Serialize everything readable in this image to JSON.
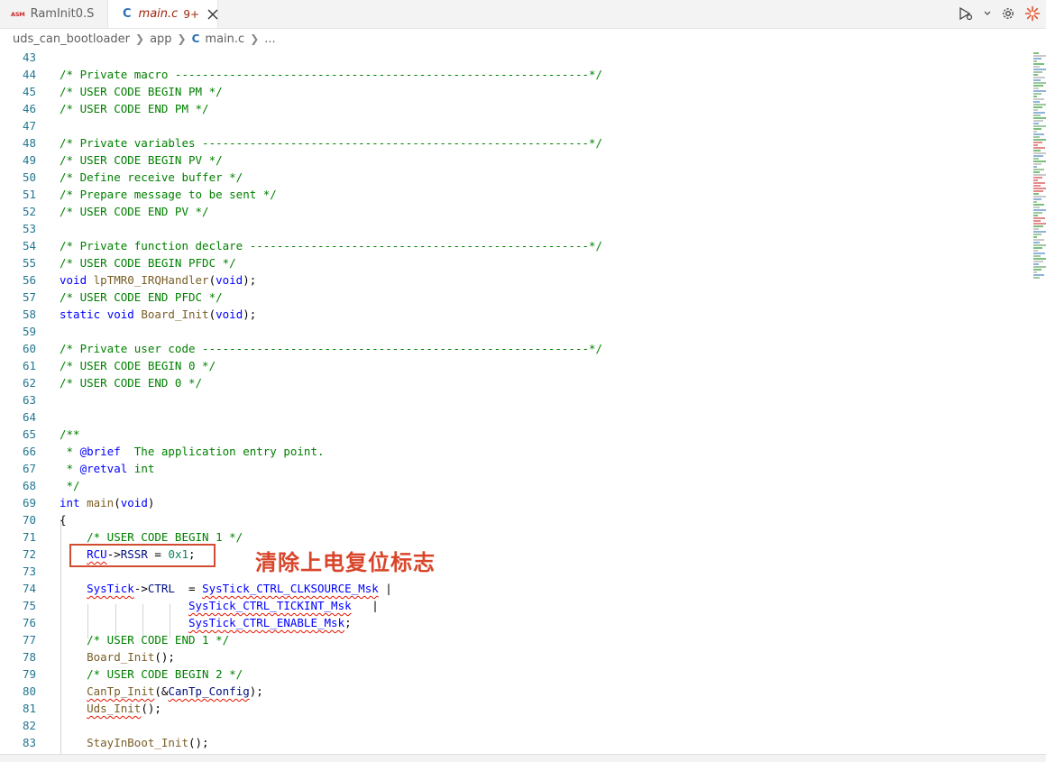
{
  "tabs": [
    {
      "badge": "ASM",
      "label": "RamInit0.S",
      "active": false
    },
    {
      "badge": "C",
      "label": "main.c",
      "problems": "9+",
      "active": true,
      "modified": true
    }
  ],
  "breadcrumb": [
    "uds_can_bootloader",
    "app",
    "main.c",
    "..."
  ],
  "annotation": {
    "text": "清除上电复位标志",
    "color": "#d8452a"
  },
  "colors": {
    "line_number": "#237893",
    "comment": "#008000",
    "keyword": "#0000ff",
    "function": "#795e26",
    "identifier": "#001080",
    "number": "#098658",
    "highlight_box": "#d14b30"
  },
  "icons": [
    "run-debug-icon",
    "chevron-down-icon",
    "gear-icon",
    "copilot-icon",
    "close-icon"
  ],
  "lines": [
    {
      "num": "43",
      "tokens": []
    },
    {
      "num": "44",
      "tokens": [
        {
          "t": "/* Private macro -------------------------------------------------------------*/",
          "c": "comment"
        }
      ]
    },
    {
      "num": "45",
      "tokens": [
        {
          "t": "/* USER CODE BEGIN PM */",
          "c": "comment"
        }
      ]
    },
    {
      "num": "46",
      "tokens": [
        {
          "t": "/* USER CODE END PM */",
          "c": "comment"
        }
      ]
    },
    {
      "num": "47",
      "tokens": []
    },
    {
      "num": "48",
      "tokens": [
        {
          "t": "/* Private variables ---------------------------------------------------------*/",
          "c": "comment"
        }
      ]
    },
    {
      "num": "49",
      "tokens": [
        {
          "t": "/* USER CODE BEGIN PV */",
          "c": "comment"
        }
      ]
    },
    {
      "num": "50",
      "tokens": [
        {
          "t": "/* Define receive buffer */",
          "c": "comment"
        }
      ]
    },
    {
      "num": "51",
      "tokens": [
        {
          "t": "/* Prepare message to be sent */",
          "c": "comment"
        }
      ]
    },
    {
      "num": "52",
      "tokens": [
        {
          "t": "/* USER CODE END PV */",
          "c": "comment"
        }
      ]
    },
    {
      "num": "53",
      "tokens": []
    },
    {
      "num": "54",
      "tokens": [
        {
          "t": "/* Private function declare --------------------------------------------------*/",
          "c": "comment"
        }
      ]
    },
    {
      "num": "55",
      "tokens": [
        {
          "t": "/* USER CODE BEGIN PFDC */",
          "c": "comment"
        }
      ]
    },
    {
      "num": "56",
      "tokens": [
        {
          "t": "void",
          "c": "keyword"
        },
        {
          "t": " ",
          "c": "plain"
        },
        {
          "t": "lpTMR0_IRQHandler",
          "c": "func"
        },
        {
          "t": "(",
          "c": "plain"
        },
        {
          "t": "void",
          "c": "keyword"
        },
        {
          "t": ");",
          "c": "plain"
        }
      ]
    },
    {
      "num": "57",
      "tokens": [
        {
          "t": "/* USER CODE END PFDC */",
          "c": "comment"
        }
      ]
    },
    {
      "num": "58",
      "tokens": [
        {
          "t": "static",
          "c": "keyword"
        },
        {
          "t": " ",
          "c": "plain"
        },
        {
          "t": "void",
          "c": "keyword"
        },
        {
          "t": " ",
          "c": "plain"
        },
        {
          "t": "Board_Init",
          "c": "func"
        },
        {
          "t": "(",
          "c": "plain"
        },
        {
          "t": "void",
          "c": "keyword"
        },
        {
          "t": ");",
          "c": "plain"
        }
      ]
    },
    {
      "num": "59",
      "tokens": []
    },
    {
      "num": "60",
      "tokens": [
        {
          "t": "/* Private user code ---------------------------------------------------------*/",
          "c": "comment"
        }
      ]
    },
    {
      "num": "61",
      "tokens": [
        {
          "t": "/* USER CODE BEGIN 0 */",
          "c": "comment"
        }
      ]
    },
    {
      "num": "62",
      "tokens": [
        {
          "t": "/* USER CODE END 0 */",
          "c": "comment"
        }
      ]
    },
    {
      "num": "63",
      "tokens": []
    },
    {
      "num": "64",
      "tokens": []
    },
    {
      "num": "65",
      "tokens": [
        {
          "t": "/**",
          "c": "comment"
        }
      ]
    },
    {
      "num": "66",
      "tokens": [
        {
          "t": " * ",
          "c": "comment"
        },
        {
          "t": "@brief",
          "c": "doctag"
        },
        {
          "t": "  The application entry point.",
          "c": "comment"
        }
      ]
    },
    {
      "num": "67",
      "tokens": [
        {
          "t": " * ",
          "c": "comment"
        },
        {
          "t": "@retval",
          "c": "doctag"
        },
        {
          "t": " int",
          "c": "comment"
        }
      ]
    },
    {
      "num": "68",
      "tokens": [
        {
          "t": " */",
          "c": "comment"
        }
      ]
    },
    {
      "num": "69",
      "tokens": [
        {
          "t": "int",
          "c": "keyword"
        },
        {
          "t": " ",
          "c": "plain"
        },
        {
          "t": "main",
          "c": "func"
        },
        {
          "t": "(",
          "c": "plain"
        },
        {
          "t": "void",
          "c": "keyword"
        },
        {
          "t": ")",
          "c": "plain"
        }
      ]
    },
    {
      "num": "70",
      "tokens": [
        {
          "t": "{",
          "c": "plain"
        }
      ]
    },
    {
      "num": "71",
      "tokens": [
        {
          "t": "    /* USER CODE BEGIN 1 */",
          "c": "comment"
        }
      ]
    },
    {
      "num": "72",
      "tokens": [
        {
          "t": "    ",
          "c": "plain"
        },
        {
          "t": "RCU",
          "c": "macro",
          "sq": true
        },
        {
          "t": "->",
          "c": "plain"
        },
        {
          "t": "RSSR",
          "c": "ident"
        },
        {
          "t": " = ",
          "c": "plain"
        },
        {
          "t": "0x1",
          "c": "number"
        },
        {
          "t": ";",
          "c": "plain"
        }
      ]
    },
    {
      "num": "73",
      "tokens": []
    },
    {
      "num": "74",
      "tokens": [
        {
          "t": "    ",
          "c": "plain"
        },
        {
          "t": "SysTick",
          "c": "macro",
          "sq": true
        },
        {
          "t": "->",
          "c": "plain"
        },
        {
          "t": "CTRL",
          "c": "ident"
        },
        {
          "t": "  = ",
          "c": "plain"
        },
        {
          "t": "SysTick_CTRL_CLKSOURCE_Msk",
          "c": "macro",
          "sq": true
        },
        {
          "t": " |",
          "c": "plain"
        }
      ]
    },
    {
      "num": "75",
      "tokens": [
        {
          "t": "                   ",
          "c": "plain"
        },
        {
          "t": "SysTick_CTRL_TICKINT_Msk",
          "c": "macro",
          "sq": true
        },
        {
          "t": "   |",
          "c": "plain"
        }
      ]
    },
    {
      "num": "76",
      "tokens": [
        {
          "t": "                   ",
          "c": "plain"
        },
        {
          "t": "SysTick_CTRL_ENABLE_Msk",
          "c": "macro",
          "sq": true
        },
        {
          "t": ";",
          "c": "plain"
        }
      ]
    },
    {
      "num": "77",
      "tokens": [
        {
          "t": "    /* USER CODE END 1 */",
          "c": "comment"
        }
      ]
    },
    {
      "num": "78",
      "tokens": [
        {
          "t": "    ",
          "c": "plain"
        },
        {
          "t": "Board_Init",
          "c": "func"
        },
        {
          "t": "();",
          "c": "plain"
        }
      ]
    },
    {
      "num": "79",
      "tokens": [
        {
          "t": "    /* USER CODE BEGIN 2 */",
          "c": "comment"
        }
      ]
    },
    {
      "num": "80",
      "tokens": [
        {
          "t": "    ",
          "c": "plain"
        },
        {
          "t": "CanTp_Init",
          "c": "func",
          "sq": true
        },
        {
          "t": "(&",
          "c": "plain"
        },
        {
          "t": "CanTp_Config",
          "c": "ident",
          "sq": true
        },
        {
          "t": ");",
          "c": "plain"
        }
      ]
    },
    {
      "num": "81",
      "tokens": [
        {
          "t": "    ",
          "c": "plain"
        },
        {
          "t": "Uds_Init",
          "c": "func",
          "sq": true
        },
        {
          "t": "();",
          "c": "plain"
        }
      ]
    },
    {
      "num": "82",
      "tokens": []
    },
    {
      "num": "83",
      "tokens": [
        {
          "t": "    ",
          "c": "plain"
        },
        {
          "t": "StayInBoot_Init",
          "c": "func"
        },
        {
          "t": "();",
          "c": "plain"
        }
      ]
    }
  ]
}
